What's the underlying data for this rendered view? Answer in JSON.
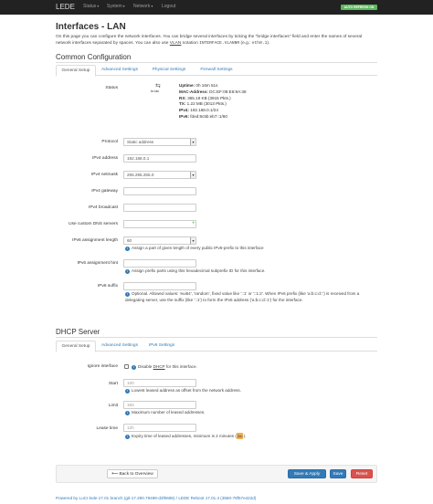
{
  "nav": {
    "brand": "LEDE",
    "menu": [
      "Status",
      "System",
      "Network",
      "Logout"
    ],
    "autorefresh": "AUTO REFRESH ON"
  },
  "page": {
    "title": "Interfaces - LAN",
    "description_1": "On this page you can configure the network interfaces. You can bridge several interfaces by ticking the \"bridge interfaces\" field and enter the names of several",
    "description_2a": "network interfaces separated by spaces. You can also use ",
    "description_vlan": "VLAN",
    "description_2b": " notation ",
    "description_code1": "INTERFACE.VLANNR",
    "description_2c": " (e.g.: ",
    "description_code2": "eth0.1",
    "description_2d": ")."
  },
  "common": {
    "heading": "Common Configuration",
    "tabs": [
      "General Setup",
      "Advanced Settings",
      "Physical Settings",
      "Firewall Settings"
    ],
    "status": {
      "label": "Status",
      "iface": "br-lan",
      "uptime_l": "Uptime:",
      "uptime_v": " 0h 16m 51s",
      "mac_l": "MAC-Address:",
      "mac_v": " DC:EF:09:E6:9A:38",
      "rx_l": "RX:",
      "rx_v": " 365.19 KB (3915 Pkts.)",
      "tx_l": "TX:",
      "tx_v": " 1.22 MB (3013 Pkts.)",
      "ipv4_l": "IPv4:",
      "ipv4_v": " 192.168.0.1/24",
      "ipv6_l": "IPv6:",
      "ipv6_v": " fded:8c5b:eb7::1/60"
    },
    "protocol": {
      "label": "Protocol",
      "value": "Static address"
    },
    "ipv4_address": {
      "label": "IPv4 address",
      "value": "192.168.0.1"
    },
    "ipv4_netmask": {
      "label": "IPv4 netmask",
      "value": "255.255.255.0"
    },
    "ipv4_gateway": {
      "label": "IPv4 gateway",
      "value": ""
    },
    "ipv4_broadcast": {
      "label": "IPv4 broadcast",
      "value": ""
    },
    "dns": {
      "label": "Use custom DNS servers",
      "value": ""
    },
    "ipv6_assign": {
      "label": "IPv6 assignment length",
      "value": "60",
      "hint": "Assign a part of given length of every public IPv6-prefix to this interface"
    },
    "ipv6_hint": {
      "label": "IPv6 assignment hint",
      "value": "",
      "hint": "Assign prefix parts using this hexadecimal subprefix ID for this interface."
    },
    "ipv6_suffix": {
      "label": "IPv6 suffix",
      "value": "",
      "hint1": "Optional. Allowed values: 'eui64', 'random', fixed value like '::1' or '::1:2'. When IPv6 prefix (like 'a:b:c:d::') is received from a",
      "hint2": "delegating server, use the suffix (like '::1') to form the IPv6 address ('a:b:c:d::1') for the interface."
    }
  },
  "dhcp": {
    "heading": "DHCP Server",
    "tabs": [
      "General Setup",
      "Advanced Settings",
      "IPv6 Settings"
    ],
    "ignore": {
      "label": "Ignore interface",
      "hint_a": "Disable ",
      "hint_dhcp": "DHCP",
      "hint_b": " for this interface."
    },
    "start": {
      "label": "Start",
      "placeholder": "100",
      "hint": "Lowest leased address as offset from the network address."
    },
    "limit": {
      "label": "Limit",
      "placeholder": "150",
      "hint": "Maximum number of leased addresses."
    },
    "leasetime": {
      "label": "Lease time",
      "placeholder": "12h",
      "hint_a": "Expiry time of leased addresses, minimum is 2 minutes (",
      "hint_tag": "2m",
      "hint_b": ")."
    }
  },
  "footer": {
    "back": "Back to Overview",
    "save_apply": "Save & Apply",
    "save": "Save",
    "reset": "Reset"
  },
  "powered": "Powered by LuCI lede-17.01 branch (git-17.290.79498-d3f0685) / LEDE Reboot 17.01.4 (3560-79f57e422d)"
}
